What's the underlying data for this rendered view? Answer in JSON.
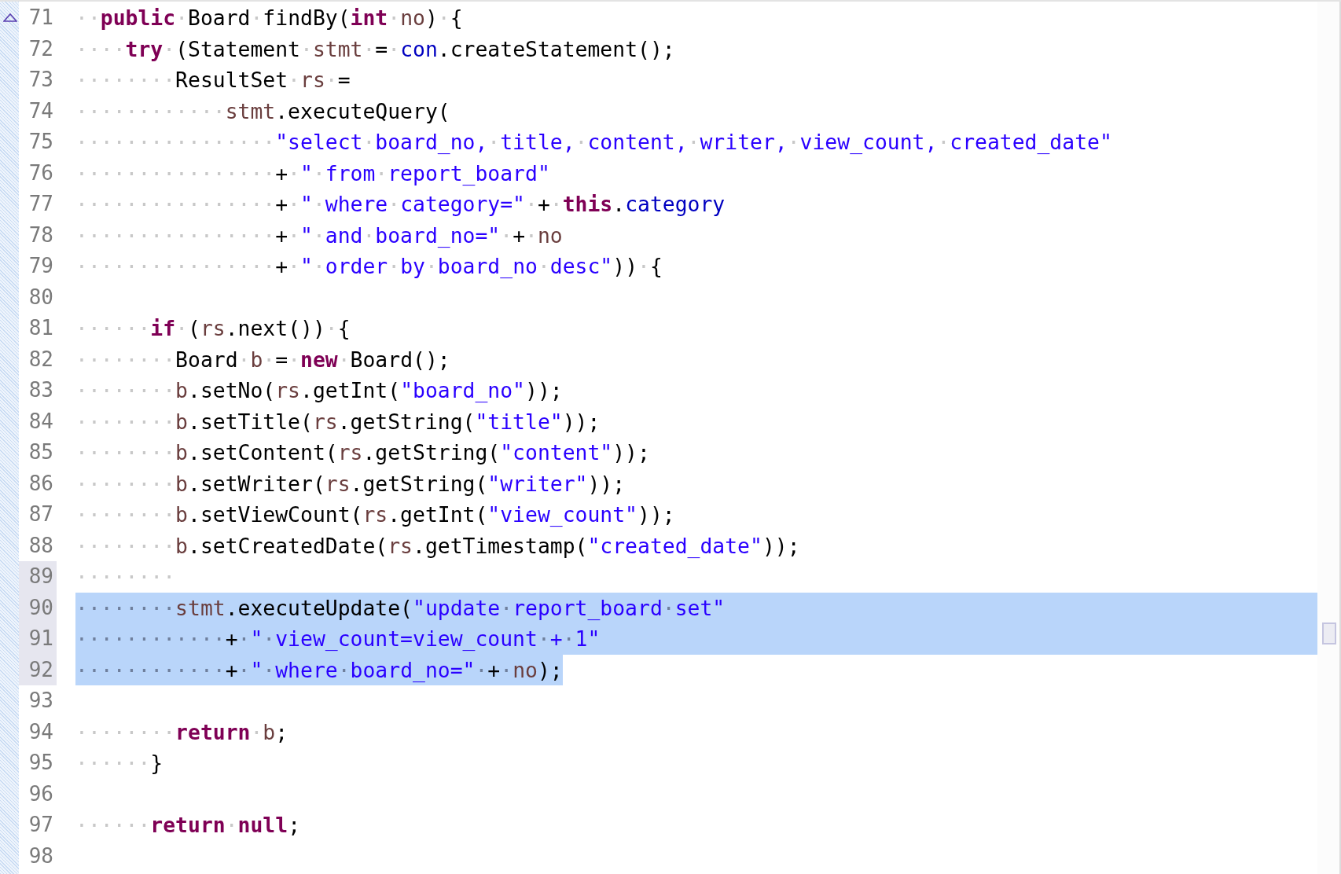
{
  "editor": {
    "lines": [
      {
        "number": "71",
        "selected": false,
        "gutter_highlight": false,
        "tokens": [
          {
            "kind": "plain",
            "text": "··"
          },
          {
            "kind": "keyword",
            "text": "public"
          },
          {
            "kind": "plain",
            "text": "·Board·findBy("
          },
          {
            "kind": "keyword",
            "text": "int"
          },
          {
            "kind": "plain",
            "text": "·"
          },
          {
            "kind": "local",
            "text": "no"
          },
          {
            "kind": "plain",
            "text": ")·{"
          }
        ]
      },
      {
        "number": "72",
        "selected": false,
        "gutter_highlight": false,
        "tokens": [
          {
            "kind": "plain",
            "text": "····"
          },
          {
            "kind": "keyword",
            "text": "try"
          },
          {
            "kind": "plain",
            "text": "·(Statement·"
          },
          {
            "kind": "local",
            "text": "stmt"
          },
          {
            "kind": "plain",
            "text": "·=·"
          },
          {
            "kind": "field",
            "text": "con"
          },
          {
            "kind": "plain",
            "text": ".createStatement();"
          }
        ]
      },
      {
        "number": "73",
        "selected": false,
        "gutter_highlight": false,
        "tokens": [
          {
            "kind": "plain",
            "text": "········ResultSet·"
          },
          {
            "kind": "local",
            "text": "rs"
          },
          {
            "kind": "plain",
            "text": "·="
          }
        ]
      },
      {
        "number": "74",
        "selected": false,
        "gutter_highlight": false,
        "tokens": [
          {
            "kind": "plain",
            "text": "············"
          },
          {
            "kind": "local",
            "text": "stmt"
          },
          {
            "kind": "plain",
            "text": ".executeQuery("
          }
        ]
      },
      {
        "number": "75",
        "selected": false,
        "gutter_highlight": false,
        "tokens": [
          {
            "kind": "plain",
            "text": "················"
          },
          {
            "kind": "string",
            "text": "\"select·board_no,·title,·content,·writer,·view_count,·created_date\""
          }
        ]
      },
      {
        "number": "76",
        "selected": false,
        "gutter_highlight": false,
        "tokens": [
          {
            "kind": "plain",
            "text": "················+·"
          },
          {
            "kind": "string",
            "text": "\"·from·report_board\""
          }
        ]
      },
      {
        "number": "77",
        "selected": false,
        "gutter_highlight": false,
        "tokens": [
          {
            "kind": "plain",
            "text": "················+·"
          },
          {
            "kind": "string",
            "text": "\"·where·category=\""
          },
          {
            "kind": "plain",
            "text": "·+·"
          },
          {
            "kind": "keyword",
            "text": "this"
          },
          {
            "kind": "plain",
            "text": "."
          },
          {
            "kind": "field",
            "text": "category"
          }
        ]
      },
      {
        "number": "78",
        "selected": false,
        "gutter_highlight": false,
        "tokens": [
          {
            "kind": "plain",
            "text": "················+·"
          },
          {
            "kind": "string",
            "text": "\"·and·board_no=\""
          },
          {
            "kind": "plain",
            "text": "·+·"
          },
          {
            "kind": "local",
            "text": "no"
          }
        ]
      },
      {
        "number": "79",
        "selected": false,
        "gutter_highlight": false,
        "tokens": [
          {
            "kind": "plain",
            "text": "················+·"
          },
          {
            "kind": "string",
            "text": "\"·order·by·board_no·desc\""
          },
          {
            "kind": "plain",
            "text": "))·{"
          }
        ]
      },
      {
        "number": "80",
        "selected": false,
        "gutter_highlight": false
      },
      {
        "number": "81",
        "selected": false,
        "gutter_highlight": false,
        "tokens": [
          {
            "kind": "plain",
            "text": "······"
          },
          {
            "kind": "keyword",
            "text": "if"
          },
          {
            "kind": "plain",
            "text": "·("
          },
          {
            "kind": "local",
            "text": "rs"
          },
          {
            "kind": "plain",
            "text": ".next())·{"
          }
        ]
      },
      {
        "number": "82",
        "selected": false,
        "gutter_highlight": false,
        "tokens": [
          {
            "kind": "plain",
            "text": "········Board·"
          },
          {
            "kind": "local",
            "text": "b"
          },
          {
            "kind": "plain",
            "text": "·=·"
          },
          {
            "kind": "keyword",
            "text": "new"
          },
          {
            "kind": "plain",
            "text": "·Board();"
          }
        ]
      },
      {
        "number": "83",
        "selected": false,
        "gutter_highlight": false,
        "tokens": [
          {
            "kind": "plain",
            "text": "········"
          },
          {
            "kind": "local",
            "text": "b"
          },
          {
            "kind": "plain",
            "text": ".setNo("
          },
          {
            "kind": "local",
            "text": "rs"
          },
          {
            "kind": "plain",
            "text": ".getInt("
          },
          {
            "kind": "string",
            "text": "\"board_no\""
          },
          {
            "kind": "plain",
            "text": "));"
          }
        ]
      },
      {
        "number": "84",
        "selected": false,
        "gutter_highlight": false,
        "tokens": [
          {
            "kind": "plain",
            "text": "········"
          },
          {
            "kind": "local",
            "text": "b"
          },
          {
            "kind": "plain",
            "text": ".setTitle("
          },
          {
            "kind": "local",
            "text": "rs"
          },
          {
            "kind": "plain",
            "text": ".getString("
          },
          {
            "kind": "string",
            "text": "\"title\""
          },
          {
            "kind": "plain",
            "text": "));"
          }
        ]
      },
      {
        "number": "85",
        "selected": false,
        "gutter_highlight": false,
        "tokens": [
          {
            "kind": "plain",
            "text": "········"
          },
          {
            "kind": "local",
            "text": "b"
          },
          {
            "kind": "plain",
            "text": ".setContent("
          },
          {
            "kind": "local",
            "text": "rs"
          },
          {
            "kind": "plain",
            "text": ".getString("
          },
          {
            "kind": "string",
            "text": "\"content\""
          },
          {
            "kind": "plain",
            "text": "));"
          }
        ]
      },
      {
        "number": "86",
        "selected": false,
        "gutter_highlight": false,
        "tokens": [
          {
            "kind": "plain",
            "text": "········"
          },
          {
            "kind": "local",
            "text": "b"
          },
          {
            "kind": "plain",
            "text": ".setWriter("
          },
          {
            "kind": "local",
            "text": "rs"
          },
          {
            "kind": "plain",
            "text": ".getString("
          },
          {
            "kind": "string",
            "text": "\"writer\""
          },
          {
            "kind": "plain",
            "text": "));"
          }
        ]
      },
      {
        "number": "87",
        "selected": false,
        "gutter_highlight": false,
        "tokens": [
          {
            "kind": "plain",
            "text": "········"
          },
          {
            "kind": "local",
            "text": "b"
          },
          {
            "kind": "plain",
            "text": ".setViewCount("
          },
          {
            "kind": "local",
            "text": "rs"
          },
          {
            "kind": "plain",
            "text": ".getInt("
          },
          {
            "kind": "string",
            "text": "\"view_count\""
          },
          {
            "kind": "plain",
            "text": "));"
          }
        ]
      },
      {
        "number": "88",
        "selected": false,
        "gutter_highlight": false,
        "tokens": [
          {
            "kind": "plain",
            "text": "········"
          },
          {
            "kind": "local",
            "text": "b"
          },
          {
            "kind": "plain",
            "text": ".setCreatedDate("
          },
          {
            "kind": "local",
            "text": "rs"
          },
          {
            "kind": "plain",
            "text": ".getTimestamp("
          },
          {
            "kind": "string",
            "text": "\"created_date\""
          },
          {
            "kind": "plain",
            "text": "));"
          }
        ]
      },
      {
        "number": "89",
        "selected": false,
        "gutter_highlight": true,
        "tokens": [
          {
            "kind": "plain",
            "text": "········"
          }
        ]
      },
      {
        "number": "90",
        "selected": true,
        "gutter_highlight": true,
        "tokens": [
          {
            "kind": "plain",
            "text": "········"
          },
          {
            "kind": "local",
            "text": "stmt"
          },
          {
            "kind": "plain",
            "text": ".executeUpdate("
          },
          {
            "kind": "string",
            "text": "\"update·report_board·set\""
          }
        ]
      },
      {
        "number": "91",
        "selected": true,
        "gutter_highlight": true,
        "tokens": [
          {
            "kind": "plain",
            "text": "············+·"
          },
          {
            "kind": "string",
            "text": "\"·view_count=view_count·+·1\""
          }
        ]
      },
      {
        "number": "92",
        "selected": true,
        "gutter_highlight": true,
        "tokens": [
          {
            "kind": "plain",
            "text": "············+·"
          },
          {
            "kind": "string",
            "text": "\"·where·board_no=\""
          },
          {
            "kind": "plain",
            "text": "·+·"
          },
          {
            "kind": "local",
            "text": "no"
          },
          {
            "kind": "plain",
            "text": ");"
          }
        ]
      },
      {
        "number": "93",
        "selected": false,
        "gutter_highlight": false
      },
      {
        "number": "94",
        "selected": false,
        "gutter_highlight": false,
        "tokens": [
          {
            "kind": "plain",
            "text": "········"
          },
          {
            "kind": "keyword",
            "text": "return"
          },
          {
            "kind": "plain",
            "text": "·"
          },
          {
            "kind": "local",
            "text": "b"
          },
          {
            "kind": "plain",
            "text": ";"
          }
        ]
      },
      {
        "number": "95",
        "selected": false,
        "gutter_highlight": false,
        "tokens": [
          {
            "kind": "plain",
            "text": "······}"
          }
        ]
      },
      {
        "number": "96",
        "selected": false,
        "gutter_highlight": false
      },
      {
        "number": "97",
        "selected": false,
        "gutter_highlight": false,
        "tokens": [
          {
            "kind": "plain",
            "text": "······"
          },
          {
            "kind": "keyword",
            "text": "return"
          },
          {
            "kind": "plain",
            "text": "·"
          },
          {
            "kind": "keyword",
            "text": "null"
          },
          {
            "kind": "plain",
            "text": ";"
          }
        ]
      },
      {
        "number": "98",
        "selected": false,
        "gutter_highlight": false
      }
    ]
  }
}
